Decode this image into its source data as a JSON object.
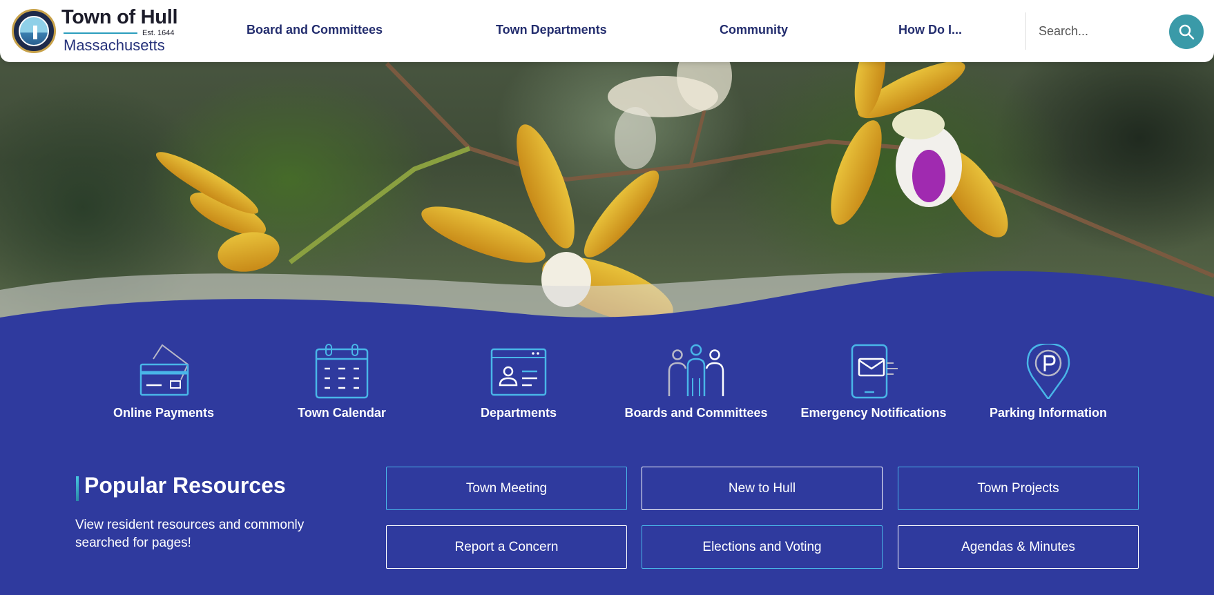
{
  "site": {
    "title": "Town of Hull",
    "established": "Est. 1644",
    "state": "Massachusetts"
  },
  "nav": {
    "items": [
      "Board and Committees",
      "Town Departments",
      "Community",
      "How Do I..."
    ]
  },
  "search": {
    "placeholder": "Search..."
  },
  "quick_links": [
    {
      "label": "Online Payments",
      "icon": "credit-card-icon"
    },
    {
      "label": "Town Calendar",
      "icon": "calendar-icon"
    },
    {
      "label": "Departments",
      "icon": "id-card-icon"
    },
    {
      "label": "Boards and Committees",
      "icon": "people-group-icon"
    },
    {
      "label": "Emergency Notifications",
      "icon": "phone-mail-icon"
    },
    {
      "label": "Parking Information",
      "icon": "parking-pin-icon"
    }
  ],
  "popular": {
    "title": "Popular Resources",
    "description": "View resident resources and commonly searched for pages!",
    "buttons": [
      "Town Meeting",
      "New to Hull",
      "Town Projects",
      "Report a Concern",
      "Elections and Voting",
      "Agendas & Minutes"
    ]
  },
  "colors": {
    "brand_blue": "#2f3a9e",
    "accent_teal": "#3a9aa8",
    "nav_text": "#232d6e",
    "icon_line": "#49b6e8"
  }
}
